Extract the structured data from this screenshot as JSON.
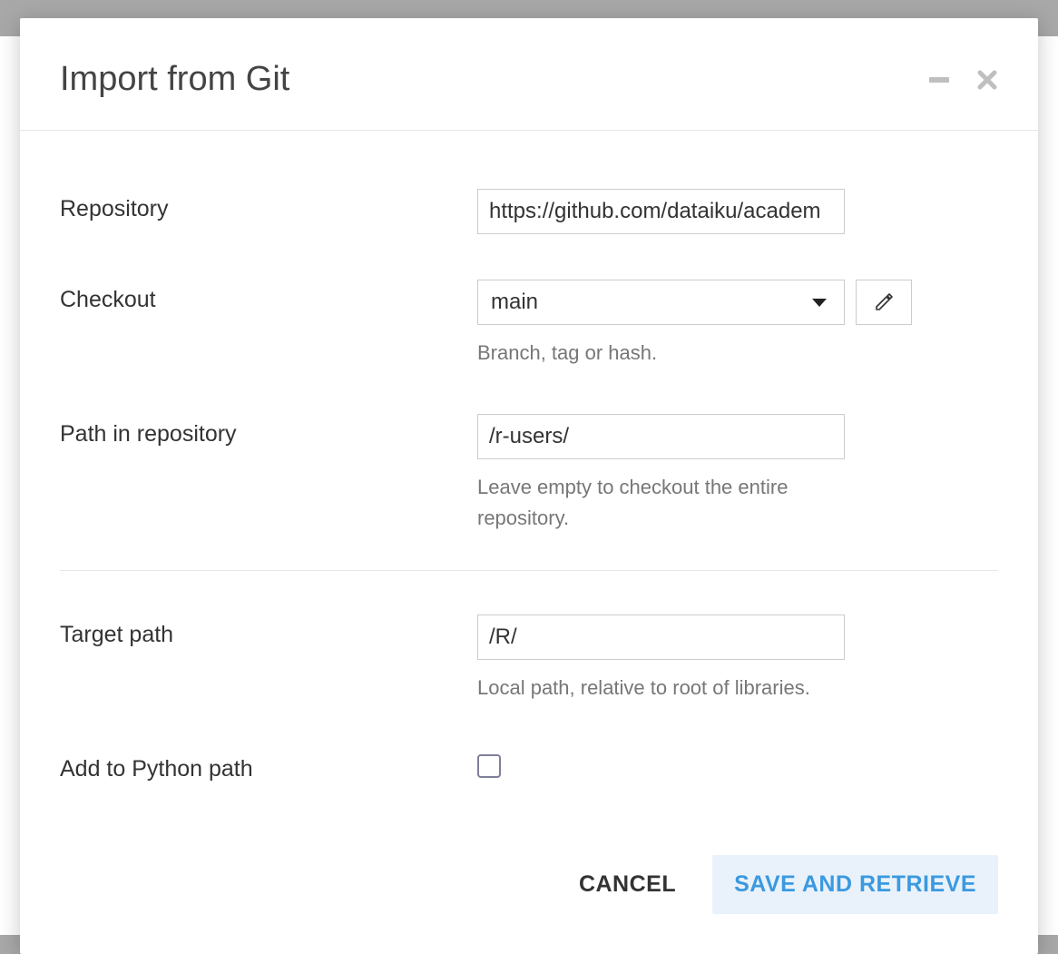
{
  "modal": {
    "title": "Import from Git",
    "fields": {
      "repository": {
        "label": "Repository",
        "value": "https://github.com/dataiku/academ"
      },
      "checkout": {
        "label": "Checkout",
        "value": "main",
        "helper": "Branch, tag or hash."
      },
      "path_in_repo": {
        "label": "Path in repository",
        "value": "/r-users/",
        "helper": "Leave empty to checkout the entire repository."
      },
      "target_path": {
        "label": "Target path",
        "value": "/R/",
        "helper": "Local path, relative to root of libraries."
      },
      "python_path": {
        "label": "Add to Python path",
        "checked": false
      }
    },
    "buttons": {
      "cancel": "CANCEL",
      "save": "SAVE AND RETRIEVE"
    }
  }
}
